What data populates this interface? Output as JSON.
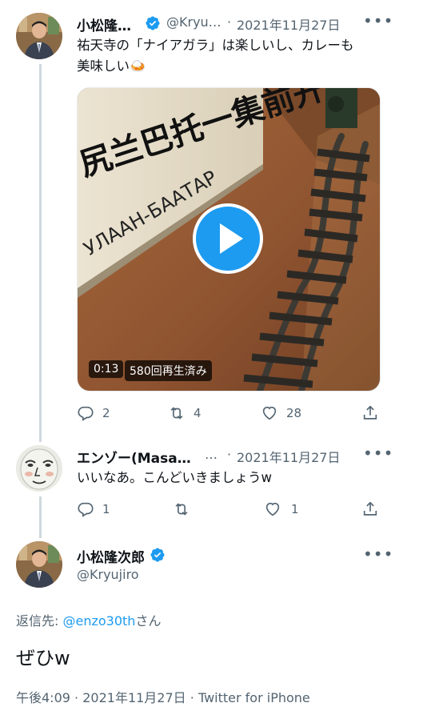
{
  "tweets": [
    {
      "author": "小松隆…",
      "handle": "@Kryu…",
      "separator": "·",
      "date": "2021年11月27日",
      "text_line1": "祐天寺の「ナイアガラ」は楽しいし、カレーも",
      "text_line2": "美味しい",
      "emoji": "🍛",
      "verified": true,
      "video": {
        "duration": "0:13",
        "views": "580回再生済み",
        "sign_text": "尻兰巴托一集前开",
        "sign_text2": "УЛААН-БААТАР"
      },
      "replies": "2",
      "retweets": "4",
      "likes": "28"
    },
    {
      "author": "エンゾー(Masa…",
      "handle": "…",
      "separator": "·",
      "date": "2021年11月27日",
      "text": "いいなあ。こんどいきましょうw",
      "replies": "1",
      "retweets": "",
      "likes": "1"
    }
  ],
  "main_tweet": {
    "author": "小松隆次郎",
    "handle": "@Kryujiro",
    "verified": true,
    "reply_to_prefix": "返信先: ",
    "reply_to_handle": "@enzo30th",
    "reply_to_suffix": "さん",
    "text": "ぜひw",
    "time": "午後4:09",
    "date": "2021年11月27日",
    "client": "Twitter for iPhone",
    "separator": "·"
  },
  "colors": {
    "accent": "#1d9bf0",
    "muted": "#536471",
    "thread_line": "#cfd9de"
  },
  "icons": [
    "verified-badge-icon",
    "more-icon",
    "reply-icon",
    "retweet-icon",
    "like-icon",
    "share-icon",
    "play-icon"
  ]
}
